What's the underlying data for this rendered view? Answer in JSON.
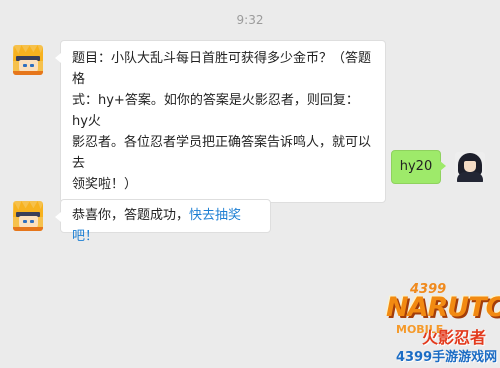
{
  "timestamp": "9:32",
  "messages": [
    {
      "side": "left",
      "sender": "naruto-bot",
      "lines": [
        "题目：小队大乱斗每日首胜可获得多少金币？（答题格",
        "式：hy+答案。如你的答案是火影忍者，则回复：hy火",
        "影忍者。各位忍者学员把正确答案告诉鸣人，就可以去",
        "领奖啦！）"
      ]
    },
    {
      "side": "right",
      "sender": "user",
      "text": "hy20"
    },
    {
      "side": "left",
      "sender": "naruto-bot",
      "text": "恭喜你，答题成功，",
      "link_text": "快去抽奖吧！"
    }
  ],
  "watermark": {
    "number": "4399",
    "logo": "NARUTO",
    "sub": "MOBILE",
    "chinese": "火影忍者",
    "site": "4399手游游戏网"
  }
}
